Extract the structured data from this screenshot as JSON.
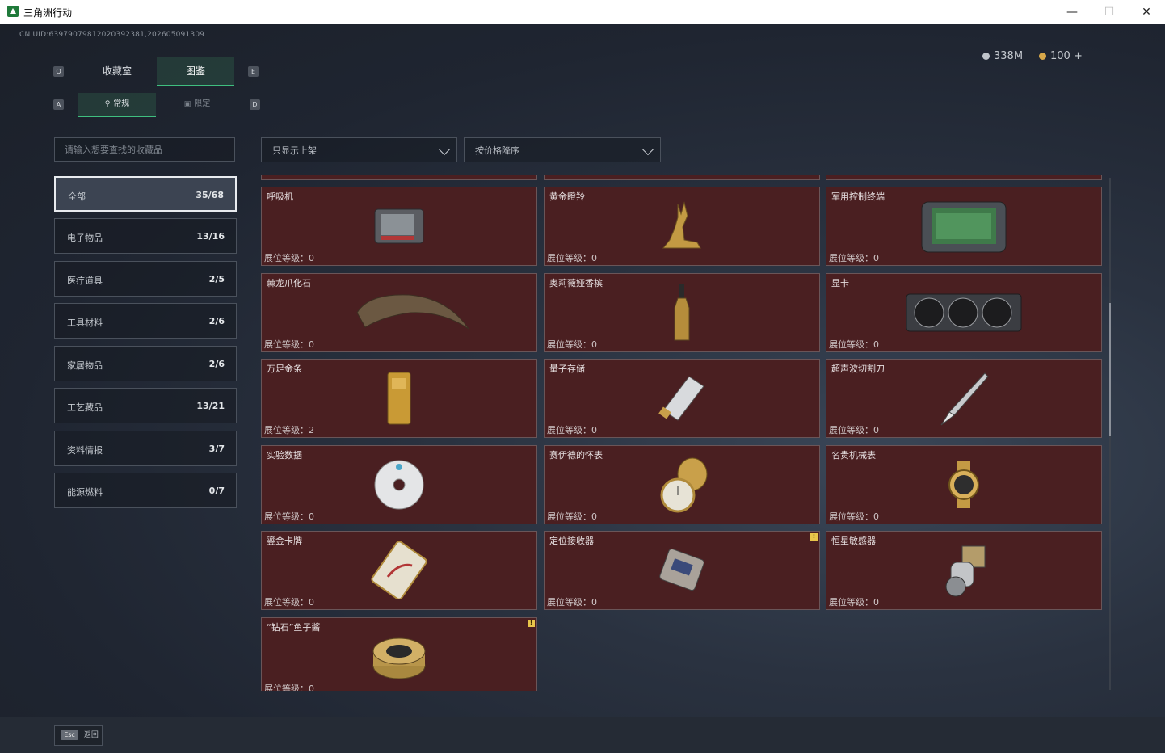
{
  "window": {
    "title": "三角洲行动"
  },
  "uid": "CN UID:6397907981202039238​1,202605091309",
  "tabs_top": [
    {
      "label": "收藏室",
      "key": "Q"
    },
    {
      "label": "图鉴",
      "key": "E"
    }
  ],
  "tabs_sub": [
    {
      "label": "常规",
      "key": "A"
    },
    {
      "label": "限定",
      "key": "D"
    }
  ],
  "currency": [
    {
      "value": "338M",
      "color": "#bfc4ca"
    },
    {
      "value": "100 +",
      "color": "#d8a84a"
    }
  ],
  "search": {
    "placeholder": "请输入想要查找的收藏品"
  },
  "filter": {
    "show": "只显示上架",
    "sort": "按价格降序"
  },
  "categories": [
    {
      "label": "全部",
      "count": "35/68"
    },
    {
      "label": "电子物品",
      "count": "13/16"
    },
    {
      "label": "医疗道具",
      "count": "2/5"
    },
    {
      "label": "工具材料",
      "count": "2/6"
    },
    {
      "label": "家居物品",
      "count": "2/6"
    },
    {
      "label": "工艺藏品",
      "count": "13/21"
    },
    {
      "label": "资料情报",
      "count": "3/7"
    },
    {
      "label": "能源燃料",
      "count": "0/7"
    }
  ],
  "level_label": "展位等级：",
  "items": [
    {
      "name": "呼吸机",
      "level": "0",
      "icon": "ventilator-icon"
    },
    {
      "name": "黄金瞪羚",
      "level": "0",
      "icon": "golden-gazelle-icon"
    },
    {
      "name": "军用控制终端",
      "level": "0",
      "icon": "control-terminal-icon"
    },
    {
      "name": "棘龙爪化石",
      "level": "0",
      "icon": "claw-fossil-icon"
    },
    {
      "name": "奥莉薇娅香槟",
      "level": "0",
      "icon": "champagne-icon"
    },
    {
      "name": "显卡",
      "level": "0",
      "icon": "graphics-card-icon"
    },
    {
      "name": "万足金条",
      "level": "2",
      "icon": "gold-bar-icon"
    },
    {
      "name": "量子存储",
      "level": "0",
      "icon": "quantum-storage-icon"
    },
    {
      "name": "超声波切割刀",
      "level": "0",
      "icon": "ultrasonic-knife-icon"
    },
    {
      "name": "实验数据",
      "level": "0",
      "icon": "data-disc-icon"
    },
    {
      "name": "赛伊德的怀表",
      "level": "0",
      "icon": "pocket-watch-icon"
    },
    {
      "name": "名贵机械表",
      "level": "0",
      "icon": "wristwatch-icon"
    },
    {
      "name": "鎏金卡牌",
      "level": "0",
      "icon": "gilded-card-icon"
    },
    {
      "name": "定位接收器",
      "level": "0",
      "icon": "gps-receiver-icon",
      "badge": "!"
    },
    {
      "name": "恒星敏感器",
      "level": "0",
      "icon": "star-sensor-icon"
    },
    {
      "name": "“钻石”鱼子酱",
      "level": "0",
      "icon": "caviar-tin-icon",
      "badge": "!"
    }
  ],
  "footer": {
    "key": "Esc",
    "label": "返回"
  }
}
